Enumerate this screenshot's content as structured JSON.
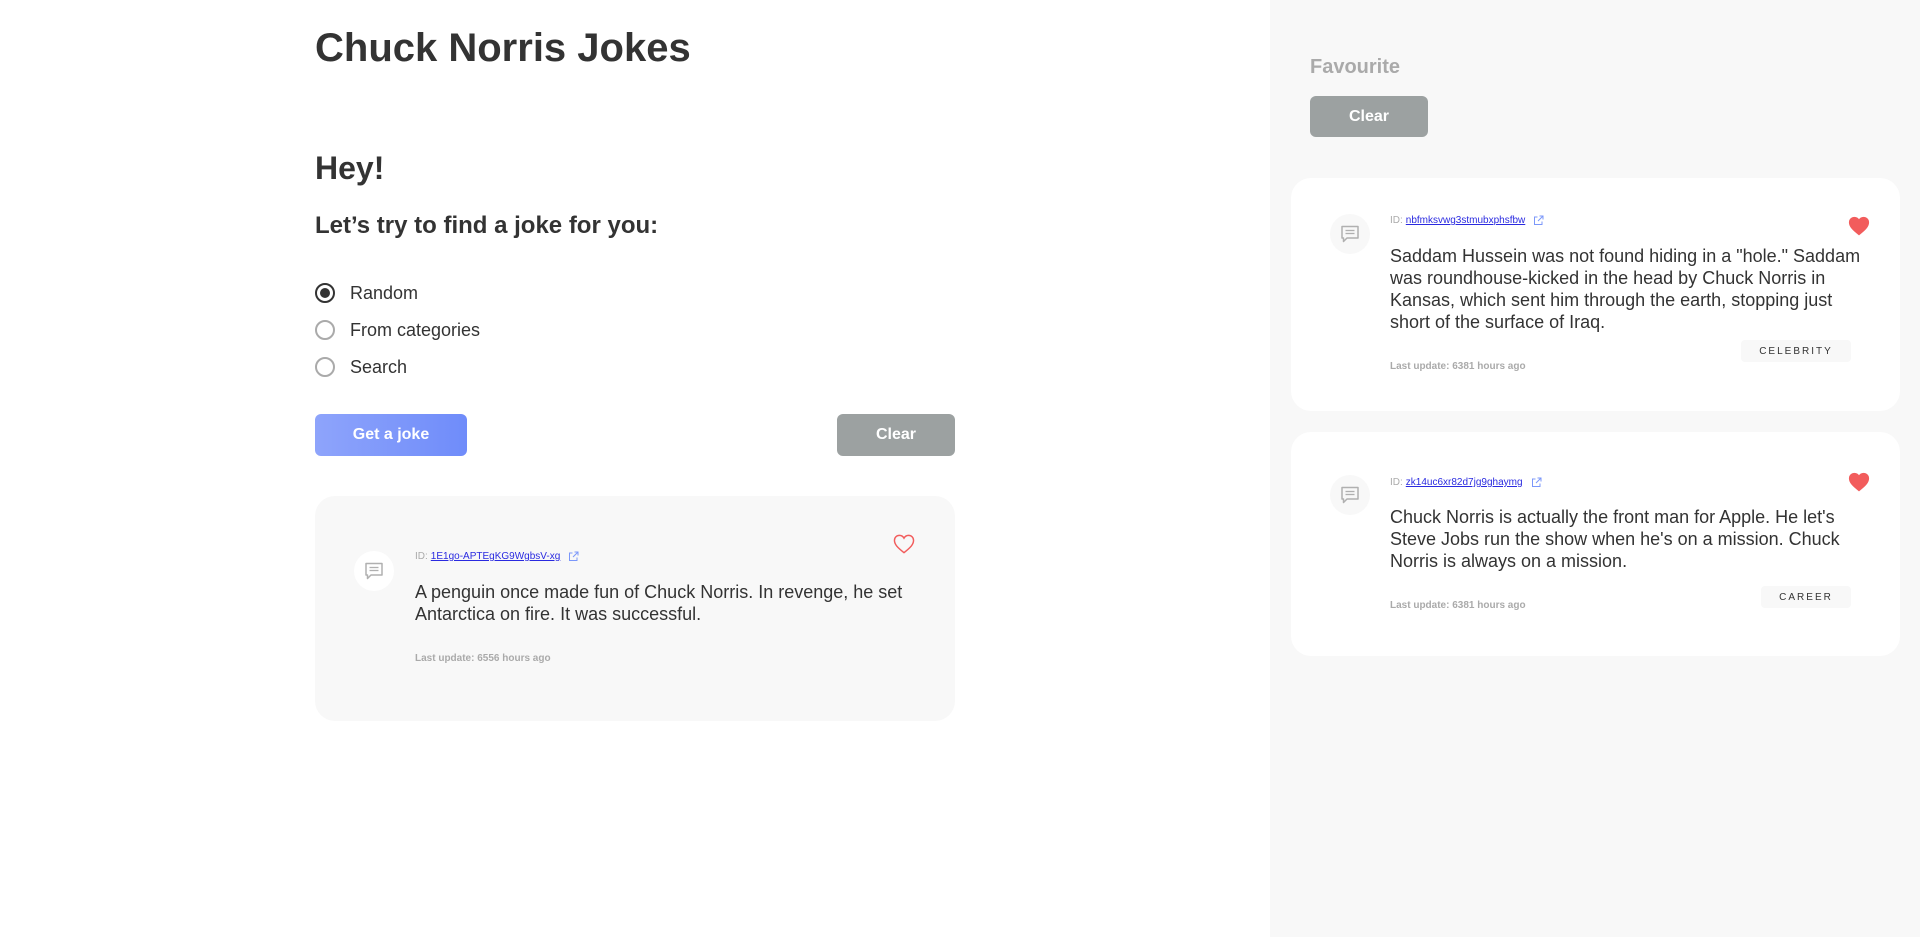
{
  "app": {
    "title": "Chuck Norris Jokes"
  },
  "greeting": "Hey!",
  "subtitle": "Let’s try to find a joke for you:",
  "options": [
    {
      "label": "Random",
      "checked": true
    },
    {
      "label": "From categories",
      "checked": false
    },
    {
      "label": "Search",
      "checked": false
    }
  ],
  "buttons": {
    "get_joke": "Get a joke",
    "clear": "Clear"
  },
  "current_joke": {
    "id_label": "ID:",
    "id": "1E1go-APTEgKG9WgbsV-xg",
    "text": "A penguin once made fun of Chuck Norris. In revenge, he set Antarctica on fire. It was successful.",
    "updated": "Last update: 6556 hours ago",
    "favourite": false
  },
  "favourites": {
    "title": "Favourite",
    "clear_label": "Clear",
    "items": [
      {
        "id_label": "ID:",
        "id": "nbfmksvwg3stmubxphsfbw",
        "text": "Saddam Hussein was not found hiding in a \"hole.\" Saddam was roundhouse-kicked in the head by Chuck Norris in Kansas, which sent him through the earth, stopping just short of the surface of Iraq.",
        "updated": "Last update: 6381 hours ago",
        "category": "CELEBRITY",
        "favourite": true
      },
      {
        "id_label": "ID:",
        "id": "zk14uc6xr82d7jg9ghaymg",
        "text": "Chuck Norris is actually the front man for Apple. He let's Steve Jobs run the show when he's on a mission. Chuck Norris is always on a mission.",
        "updated": "Last update: 6381 hours ago",
        "category": "CAREER",
        "favourite": true
      }
    ]
  },
  "icons": {
    "comment": "comment-icon",
    "external_link": "external-link-icon",
    "heart_outline": "heart-outline-icon",
    "heart_filled": "heart-filled-icon"
  },
  "colors": {
    "primary": "#7b97fa",
    "grey_button": "#9ca1a1",
    "heart": "#f25c5c",
    "sidebar_bg": "#f8f8f8",
    "text": "#333333",
    "muted": "#aaaaaa",
    "link": "#2a2ae0"
  }
}
